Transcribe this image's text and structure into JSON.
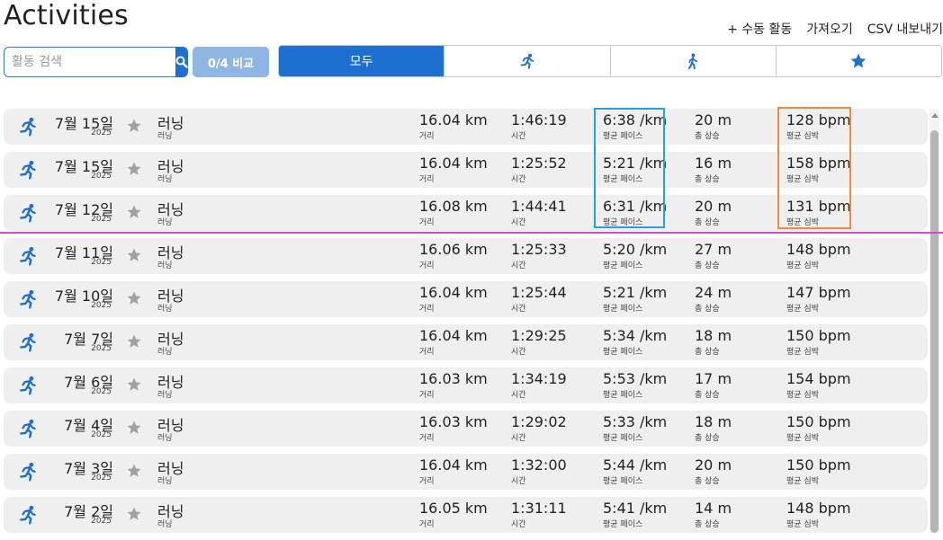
{
  "header": {
    "title": "Activities",
    "actions": {
      "manual": "+ 수동 활동",
      "import": "가져오기",
      "export": "CSV 내보내기"
    }
  },
  "toolbar": {
    "search_placeholder": "활동 검색",
    "compare_label": "0/4 비교",
    "filters": {
      "all": "모두",
      "running_icon": "running-icon",
      "walking_icon": "walking-icon",
      "favorites_icon": "star-icon"
    }
  },
  "colors": {
    "accent": "#1d6fd0",
    "compare": "#8fb6e3",
    "row_bg": "#efefef",
    "highlight_blue": "#2a9fd8",
    "highlight_orange": "#f08a3c",
    "divider_magenta": "#d44ad4"
  },
  "labels": {
    "distance": "거리",
    "time": "시간",
    "pace": "평균 페이스",
    "elevation": "총 상승",
    "heart_rate": "평균 심박"
  },
  "activities": [
    {
      "date": "7월 15일",
      "year": "2025",
      "name": "러닝",
      "type": "러닝",
      "distance": "16.04 km",
      "time": "1:46:19",
      "pace": "6:38 /km",
      "elevation": "20 m",
      "hr": "128 bpm"
    },
    {
      "date": "7월 15일",
      "year": "2025",
      "name": "러닝",
      "type": "러닝",
      "distance": "16.04 km",
      "time": "1:25:52",
      "pace": "5:21 /km",
      "elevation": "16 m",
      "hr": "158 bpm"
    },
    {
      "date": "7월 12일",
      "year": "2025",
      "name": "러닝",
      "type": "러닝",
      "distance": "16.08 km",
      "time": "1:44:41",
      "pace": "6:31 /km",
      "elevation": "20 m",
      "hr": "131 bpm"
    },
    {
      "date": "7월 11일",
      "year": "2025",
      "name": "러닝",
      "type": "러닝",
      "distance": "16.06 km",
      "time": "1:25:33",
      "pace": "5:20 /km",
      "elevation": "27 m",
      "hr": "148 bpm"
    },
    {
      "date": "7월 10일",
      "year": "2025",
      "name": "러닝",
      "type": "러닝",
      "distance": "16.04 km",
      "time": "1:25:44",
      "pace": "5:21 /km",
      "elevation": "24 m",
      "hr": "147 bpm"
    },
    {
      "date": "7월 7일",
      "year": "2025",
      "name": "러닝",
      "type": "러닝",
      "distance": "16.04 km",
      "time": "1:29:25",
      "pace": "5:34 /km",
      "elevation": "18 m",
      "hr": "150 bpm"
    },
    {
      "date": "7월 6일",
      "year": "2025",
      "name": "러닝",
      "type": "러닝",
      "distance": "16.03 km",
      "time": "1:34:19",
      "pace": "5:53 /km",
      "elevation": "17 m",
      "hr": "154 bpm"
    },
    {
      "date": "7월 4일",
      "year": "2025",
      "name": "러닝",
      "type": "러닝",
      "distance": "16.03 km",
      "time": "1:29:02",
      "pace": "5:33 /km",
      "elevation": "18 m",
      "hr": "150 bpm"
    },
    {
      "date": "7월 3일",
      "year": "2025",
      "name": "러닝",
      "type": "러닝",
      "distance": "16.04 km",
      "time": "1:32:00",
      "pace": "5:44 /km",
      "elevation": "20 m",
      "hr": "150 bpm"
    },
    {
      "date": "7월 2일",
      "year": "2025",
      "name": "러닝",
      "type": "러닝",
      "distance": "16.05 km",
      "time": "1:31:11",
      "pace": "5:41 /km",
      "elevation": "14 m",
      "hr": "148 bpm"
    }
  ]
}
